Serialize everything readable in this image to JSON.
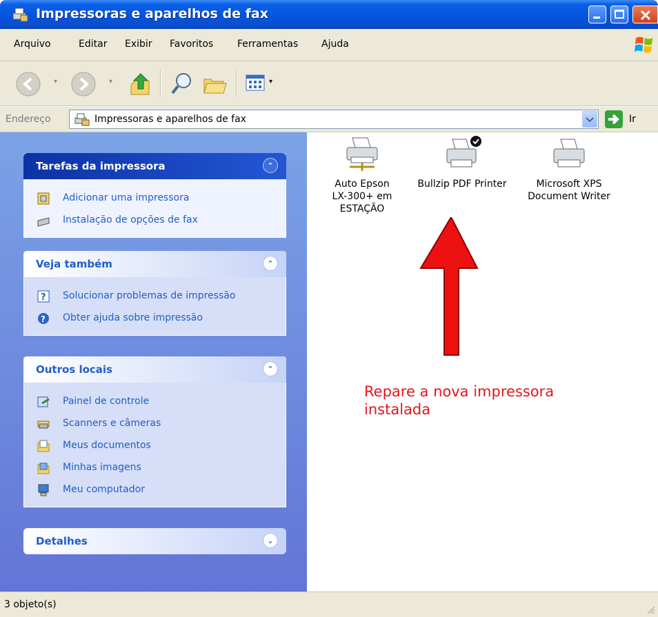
{
  "window": {
    "title": "Impressoras e aparelhos de fax"
  },
  "menu": [
    "Arquivo",
    "Editar",
    "Exibir",
    "Favoritos",
    "Ferramentas",
    "Ajuda"
  ],
  "address": {
    "label": "Endereço",
    "value": "Impressoras e aparelhos de fax",
    "go": "Ir"
  },
  "panels": {
    "printer_tasks": {
      "title": "Tarefas da impressora",
      "links": [
        "Adicionar uma impressora",
        "Instalação de opções de fax"
      ]
    },
    "see_also": {
      "title": "Veja também",
      "links": [
        "Solucionar problemas de impressão",
        "Obter ajuda sobre impressão"
      ]
    },
    "other_places": {
      "title": "Outros locais",
      "links": [
        "Painel de controle",
        "Scanners e câmeras",
        "Meus documentos",
        "Minhas imagens",
        "Meu computador"
      ]
    },
    "details": {
      "title": "Detalhes"
    }
  },
  "printers": [
    {
      "line1": "Auto Epson",
      "line2": "LX-300+ em",
      "line3": "ESTAÇÃO"
    },
    {
      "line1": "Bullzip PDF Printer",
      "line2": "",
      "line3": ""
    },
    {
      "line1": "Microsoft XPS",
      "line2": "Document Writer",
      "line3": ""
    }
  ],
  "annotation": {
    "line1": "Repare a nova impressora",
    "line2": "instalada",
    "color": "#e4151b"
  },
  "status": {
    "text": "3 objeto(s)"
  }
}
